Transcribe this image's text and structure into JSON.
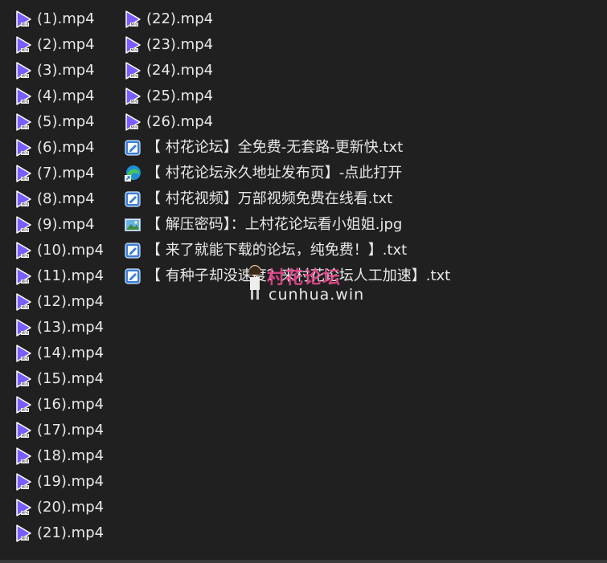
{
  "column1": [
    {
      "label": "(1).mp4",
      "icon": "mp4-file-icon"
    },
    {
      "label": "(2).mp4",
      "icon": "mp4-file-icon"
    },
    {
      "label": "(3).mp4",
      "icon": "mp4-file-icon"
    },
    {
      "label": "(4).mp4",
      "icon": "mp4-file-icon"
    },
    {
      "label": "(5).mp4",
      "icon": "mp4-file-icon"
    },
    {
      "label": "(6).mp4",
      "icon": "mp4-file-icon"
    },
    {
      "label": "(7).mp4",
      "icon": "mp4-file-icon"
    },
    {
      "label": "(8).mp4",
      "icon": "mp4-file-icon"
    },
    {
      "label": "(9).mp4",
      "icon": "mp4-file-icon"
    },
    {
      "label": "(10).mp4",
      "icon": "mp4-file-icon"
    },
    {
      "label": "(11).mp4",
      "icon": "mp4-file-icon"
    },
    {
      "label": "(12).mp4",
      "icon": "mp4-file-icon"
    },
    {
      "label": "(13).mp4",
      "icon": "mp4-file-icon"
    },
    {
      "label": "(14).mp4",
      "icon": "mp4-file-icon"
    },
    {
      "label": "(15).mp4",
      "icon": "mp4-file-icon"
    },
    {
      "label": "(16).mp4",
      "icon": "mp4-file-icon"
    },
    {
      "label": "(17).mp4",
      "icon": "mp4-file-icon"
    },
    {
      "label": "(18).mp4",
      "icon": "mp4-file-icon"
    },
    {
      "label": "(19).mp4",
      "icon": "mp4-file-icon"
    },
    {
      "label": "(20).mp4",
      "icon": "mp4-file-icon"
    },
    {
      "label": "(21).mp4",
      "icon": "mp4-file-icon"
    }
  ],
  "column2": [
    {
      "label": "(22).mp4",
      "icon": "mp4-file-icon"
    },
    {
      "label": "(23).mp4",
      "icon": "mp4-file-icon"
    },
    {
      "label": "(24).mp4",
      "icon": "mp4-file-icon"
    },
    {
      "label": "(25).mp4",
      "icon": "mp4-file-icon"
    },
    {
      "label": "(26).mp4",
      "icon": "mp4-file-icon"
    },
    {
      "label": "【 村花论坛】全免费-无套路-更新快.txt",
      "icon": "text-file-icon"
    },
    {
      "label": "【 村花论坛永久地址发布页】-点此打开",
      "icon": "edge-shortcut-icon"
    },
    {
      "label": "【 村花视频】万部视频免费在线看.txt",
      "icon": "text-file-icon"
    },
    {
      "label": "【 解压密码】：上村花论坛看小姐姐.jpg",
      "icon": "image-file-icon"
    },
    {
      "label": "【 来了就能下载的论坛，纯免费！】.txt",
      "icon": "text-file-icon"
    },
    {
      "label": "【 有种子却没速度？来村花论坛人工加速】.txt",
      "icon": "text-file-icon"
    }
  ],
  "watermark": {
    "title": "村花论坛",
    "url": "cunhua.win"
  },
  "colors": {
    "background": "#202020",
    "text": "#e8e8e8",
    "play_icon": "#7b5cff",
    "watermark": "#e8488f"
  }
}
